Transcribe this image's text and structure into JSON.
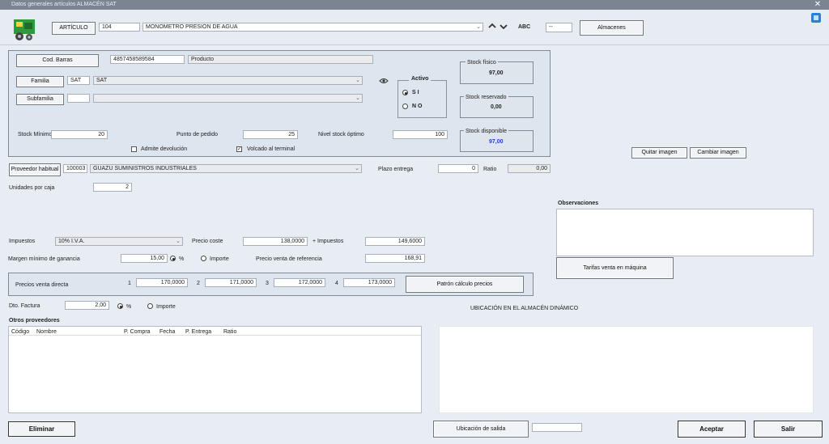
{
  "window": {
    "title": "Datos generales artículos ALMACÉN SAT",
    "close": "✕"
  },
  "header": {
    "articulo_label": "ARTÍCULO",
    "code": "104",
    "description": "MONOMETRO PRESIÓN DE AGUA",
    "abc_label": "ABC",
    "abc_value": "--",
    "almacenes_label": "Almacenes"
  },
  "general": {
    "cod_barras_label": "Cod. Barras",
    "cod_barras_value": "4857458589584",
    "producto_value": "Producto",
    "familia_label": "Familia",
    "familia_code": "SAT",
    "familia_value": "SAT",
    "subfamilia_label": "Subfamilia",
    "subfamilia_code": "",
    "subfamilia_value": "",
    "activo_label": "Activo",
    "activo_si": "S I",
    "activo_no": "N O",
    "stock_fisico_label": "Stock físico",
    "stock_fisico_value": "97,00",
    "stock_reservado_label": "Stock reservado",
    "stock_reservado_value": "0,00",
    "stock_disponible_label": "Stock disponible",
    "stock_disponible_value": "97,00",
    "stock_minimo_label": "Stock Mínimo",
    "stock_minimo_value": "20",
    "punto_pedido_label": "Punto de pedido",
    "punto_pedido_value": "25",
    "nivel_stock_label": "Nivel stock óptimo",
    "nivel_stock_value": "100",
    "admite_devolucion_label": "Admite devolución",
    "volcado_terminal_label": "Volcado al terminal",
    "volcado_check": "✓"
  },
  "image_buttons": {
    "quitar": "Quitar imagen",
    "cambiar": "Cambiar imagen"
  },
  "proveedor": {
    "label": "Proveedor habitual",
    "code": "100003",
    "name": "GUAZU SUMINISTROS INDUSTRIALES",
    "plazo_label": "Plazo entrega",
    "plazo_value": "0",
    "ratio_label": "Ratio",
    "ratio_value": "0,00",
    "unidades_label": "Unidades por caja",
    "unidades_value": "2"
  },
  "observaciones_label": "Observaciones",
  "tarifas_label": "Tarifas venta en máquina",
  "precios": {
    "impuestos_label": "Impuestos",
    "impuestos_value": "10% I.V.A.",
    "precio_coste_label": "Precio coste",
    "precio_coste_value": "138,0000",
    "mas_impuestos_label": "+ Impuestos",
    "mas_impuestos_value": "149,6000",
    "margen_label": "Margen mínimo de ganancia",
    "margen_value": "15,00",
    "pct_label": "%",
    "importe_label": "Importe",
    "precio_ref_label": "Precio venta de referencia",
    "precio_ref_value": "168,91",
    "pvd_label": "Precios venta directa",
    "pvd": [
      {
        "n": "1",
        "v": "170,0000"
      },
      {
        "n": "2",
        "v": "171,0000"
      },
      {
        "n": "3",
        "v": "172,0000"
      },
      {
        "n": "4",
        "v": "173,0000"
      }
    ],
    "patron_label": "Patrón cálculo precios",
    "dto_label": "Dto. Factura",
    "dto_value": "2,00"
  },
  "otros": {
    "title": "Otros proveedores",
    "columns": [
      "Código",
      "Nombre",
      "P. Compra",
      "Fecha",
      "P. Entrega",
      "Ratio"
    ]
  },
  "ubicacion_label": "UBICACIÓN EN EL ALMACÉN DINÁMICO",
  "footer": {
    "eliminar": "Eliminar",
    "ubicacion_salida": "Ubicación de salida",
    "ubicacion_value": "",
    "aceptar": "Aceptar",
    "salir": "Salir"
  },
  "colors": {
    "accent_blue": "#1f3fd6",
    "titlebar": "#7a8591"
  }
}
